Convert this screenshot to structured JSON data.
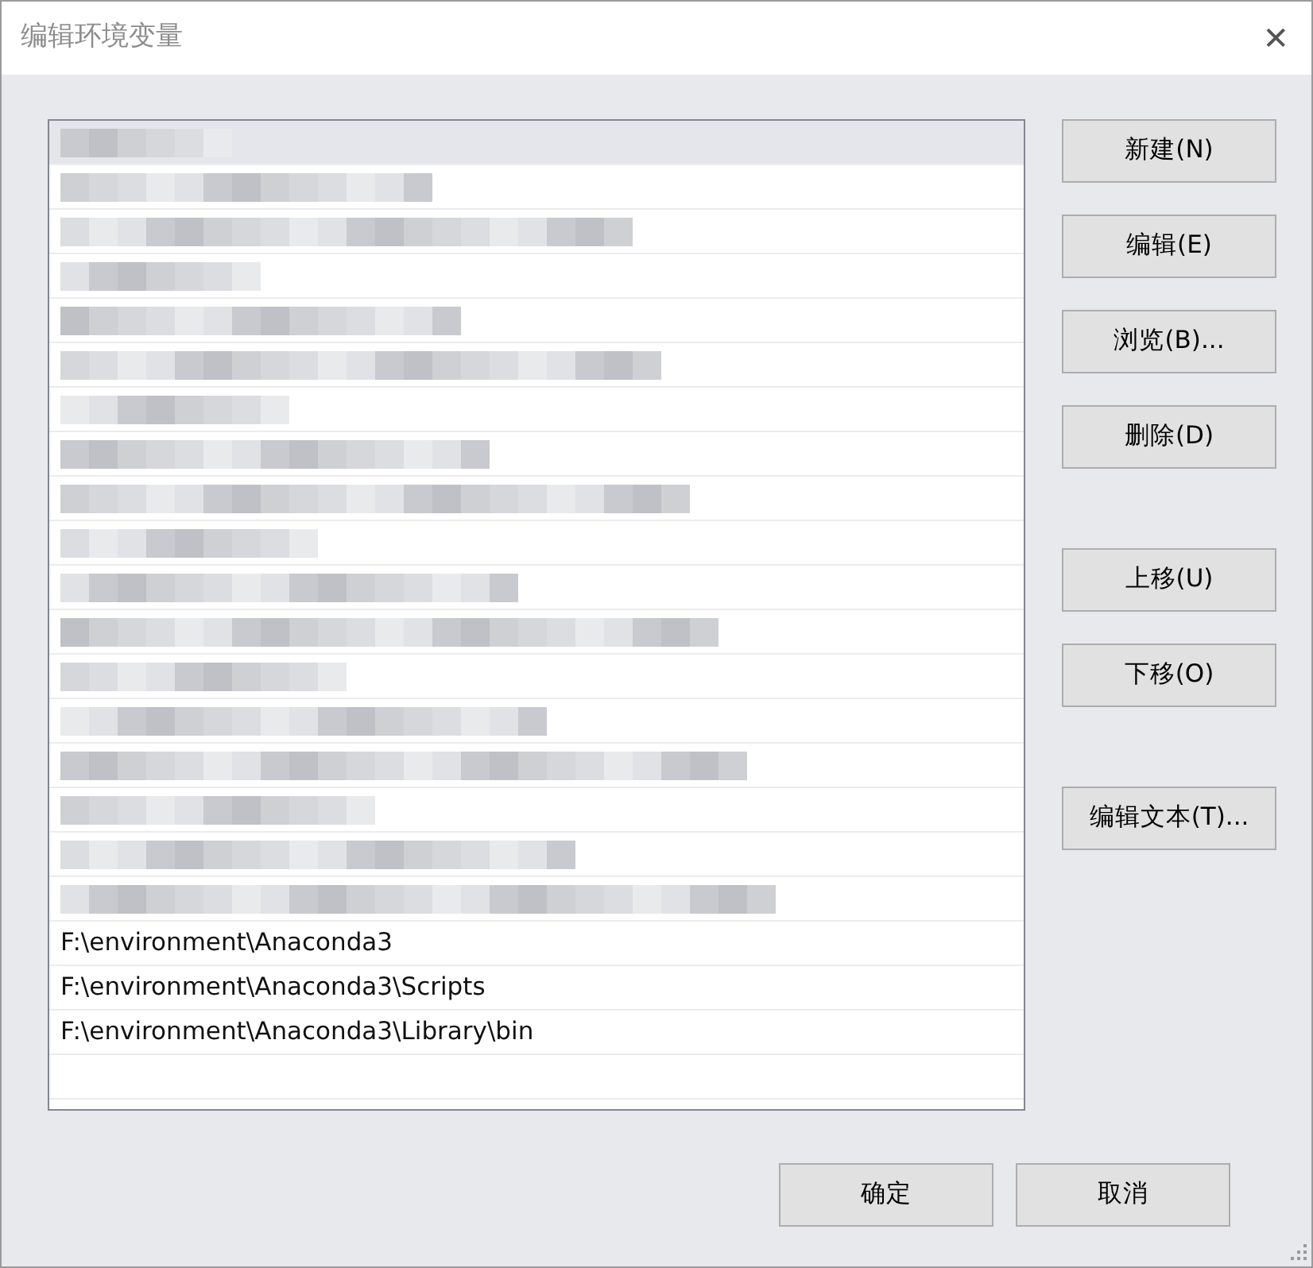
{
  "window": {
    "title": "编辑环境变量",
    "close": "✕"
  },
  "list": {
    "rows": [
      {
        "kind": "redacted",
        "selected": true
      },
      {
        "kind": "redacted",
        "selected": false
      },
      {
        "kind": "redacted",
        "selected": false
      },
      {
        "kind": "redacted",
        "selected": false
      },
      {
        "kind": "redacted",
        "selected": false
      },
      {
        "kind": "redacted",
        "selected": false
      },
      {
        "kind": "redacted",
        "selected": false
      },
      {
        "kind": "redacted",
        "selected": false
      },
      {
        "kind": "redacted",
        "selected": false
      },
      {
        "kind": "redacted",
        "selected": false
      },
      {
        "kind": "redacted",
        "selected": false
      },
      {
        "kind": "redacted",
        "selected": false
      },
      {
        "kind": "redacted",
        "selected": false
      },
      {
        "kind": "redacted",
        "selected": false
      },
      {
        "kind": "redacted",
        "selected": false
      },
      {
        "kind": "redacted",
        "selected": false
      },
      {
        "kind": "redacted",
        "selected": false
      },
      {
        "kind": "redacted",
        "selected": false
      },
      {
        "kind": "text",
        "text": "F:\\environment\\Anaconda3",
        "selected": false
      },
      {
        "kind": "text",
        "text": "F:\\environment\\Anaconda3\\Scripts",
        "selected": false
      },
      {
        "kind": "text",
        "text": "F:\\environment\\Anaconda3\\Library\\bin",
        "selected": false
      },
      {
        "kind": "empty",
        "selected": false
      }
    ]
  },
  "side_button_groups": [
    [
      "新建(N)",
      "编辑(E)",
      "浏览(B)...",
      "删除(D)"
    ],
    [
      "上移(U)",
      "下移(O)"
    ],
    [
      "编辑文本(T)..."
    ]
  ],
  "footer_buttons": [
    "确定",
    "取消"
  ]
}
